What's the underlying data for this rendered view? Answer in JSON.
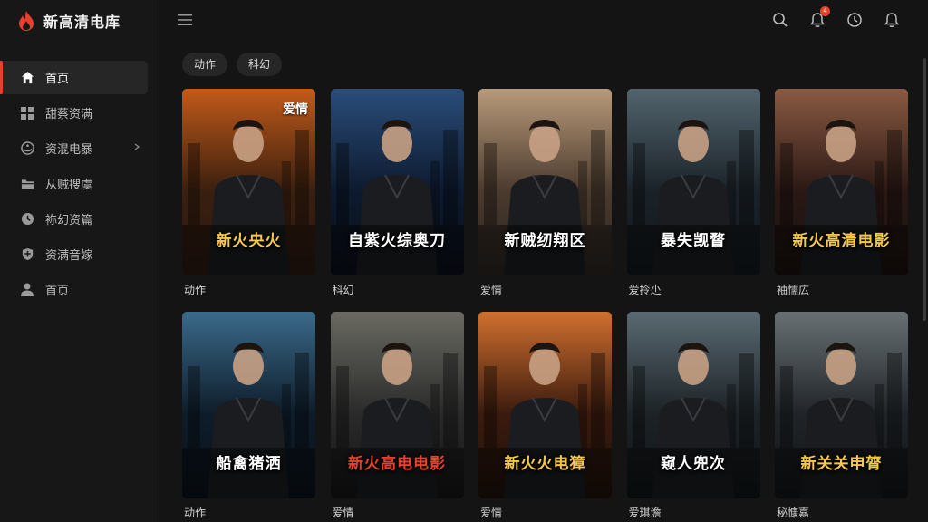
{
  "app": {
    "title": "新高清电库"
  },
  "sidebar": {
    "items": [
      {
        "label": "首页",
        "icon": "home-icon",
        "active": true
      },
      {
        "label": "甜蔡资满",
        "icon": "grid-icon"
      },
      {
        "label": "资混电暴",
        "icon": "film-reel-icon",
        "has_chevron": true
      },
      {
        "label": "从贼搜虞",
        "icon": "folder-icon"
      },
      {
        "label": "袮幻资篇",
        "icon": "clock-icon"
      },
      {
        "label": "资满音嫁",
        "icon": "shield-icon"
      },
      {
        "label": "首页",
        "icon": "user-icon"
      }
    ]
  },
  "header": {
    "notification_count": "4",
    "icons": [
      "search-icon",
      "notification-bell-icon",
      "history-icon",
      "alert-bell-icon"
    ]
  },
  "filters": [
    "动作",
    "科幻"
  ],
  "movies": [
    {
      "poster_title": "新火央火",
      "caption": "动作",
      "corner": "爱情",
      "title_color": "#f5c84a"
    },
    {
      "poster_title": "自紫火综奥刀",
      "caption": "科幻",
      "corner": "",
      "title_color": "#ffffff"
    },
    {
      "poster_title": "新贼纫翔区",
      "caption": "爱情",
      "corner": "",
      "title_color": "#ffffff"
    },
    {
      "poster_title": "暴失觊瞀",
      "caption": "爱拎尐",
      "corner": "",
      "title_color": "#ffffff"
    },
    {
      "poster_title": "新火高清电影",
      "caption": "袖懦広",
      "corner": "",
      "title_color": "#f5c84a"
    },
    {
      "poster_title": "船禽猪洒",
      "caption": "动作",
      "corner": "",
      "title_color": "#ffffff"
    },
    {
      "poster_title": "新火高电电影",
      "caption": "爱情",
      "corner": "",
      "title_color": "#e8402c"
    },
    {
      "poster_title": "新火火电獐",
      "caption": "爱情",
      "corner": "",
      "title_color": "#f5c84a"
    },
    {
      "poster_title": "窥人兜次",
      "caption": "爱琪澹",
      "corner": "",
      "title_color": "#ffffff"
    },
    {
      "poster_title": "新关关申膂",
      "caption": "秘慷嘉",
      "corner": "",
      "title_color": "#f5c84a"
    }
  ],
  "colors": {
    "accent": "#e8402c",
    "background": "#141414",
    "sidebar": "#171717"
  }
}
